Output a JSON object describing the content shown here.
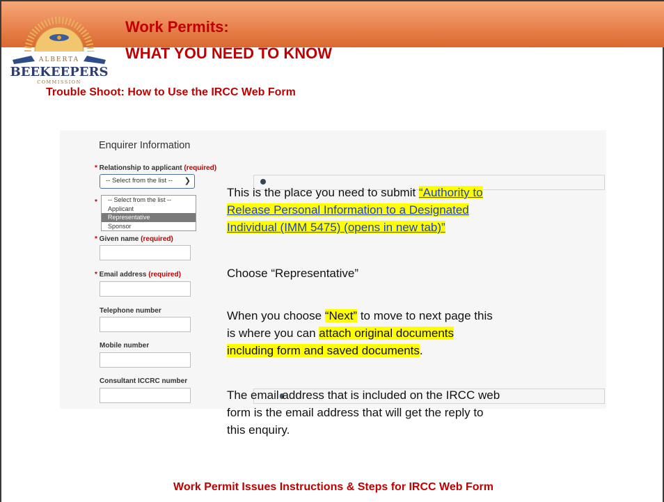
{
  "header": {
    "title": "Work Permits:",
    "subtitle": "WHAT YOU NEED TO KNOW",
    "logo_top": "ALBERTA",
    "logo_main": "BEEKEEPERS",
    "logo_bottom": "COMMISSION"
  },
  "section_title": "Trouble Shoot: How to Use the  IRCC Web Form",
  "form": {
    "heading": "Enquirer Information",
    "relationship_label": "Relationship to applicant",
    "required_text": "(required)",
    "select_value": "-- Select from the list --",
    "options": [
      "-- Select from the list --",
      "Applicant",
      "Representative",
      "Sponsor"
    ],
    "selected_option": "Representative",
    "given_name_label": "Given name",
    "email_label": "Email address",
    "telephone_label": "Telephone number",
    "mobile_label": "Mobile number",
    "consultant_label": "Consultant ICCRC number"
  },
  "notes": {
    "para1_intro": "This is the place you need to submit ",
    "para1_link_line1": "“Authority to",
    "para1_link_line2": "Release Personal Information to a Designated",
    "para1_link_line3": "Individual (IMM 5475)  (opens in new tab)”",
    "para2": "Choose “Representative”",
    "para3_a": "When you choose ",
    "para3_next": "“Next”",
    "para3_b": " to move to next page this",
    "para3_c": "is where you can ",
    "para3_attach1": "attach original documents",
    "para3_attach2": "including form and saved documents",
    "para3_end": ".",
    "para4_line1": "The email address that is included on the IRCC web",
    "para4_line2": "form is the email address that will get the reply to",
    "para4_line3": "this enquiry."
  },
  "footer": "Work Permit Issues Instructions & Steps for IRCC Web Form",
  "colors": {
    "accent_red": "#c00000",
    "header_orange": "#e8834f",
    "highlight": "#ffff00",
    "link_blue": "#1f3fd1"
  }
}
